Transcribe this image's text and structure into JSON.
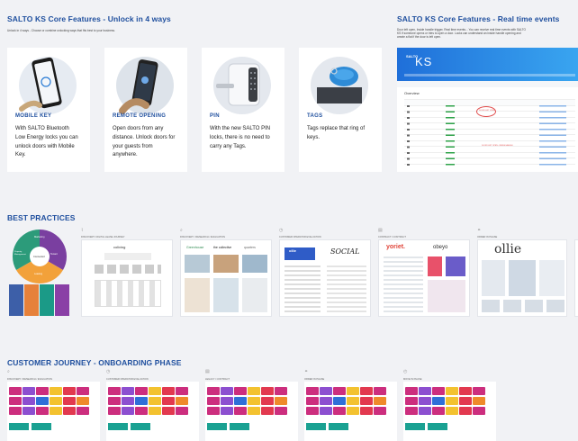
{
  "unlock_section": {
    "title": "SALTO KS Core Features  - Unlock in 4 ways",
    "subtitle": "Unlock in 4 ways - Choose or combine unlocking ways that fits best to your business.",
    "cards": [
      {
        "title": "MOBILE KEY",
        "description": "With SALTO Bluetooth Low Energy locks you can unlock doors with Mobile Key.",
        "icon": "smartphone-icon"
      },
      {
        "title": "REMOTE OPENING",
        "description": "Open doors from any distance. Unlock doors for your guests from anywhere.",
        "icon": "phone-in-hand-icon"
      },
      {
        "title": "PIN",
        "description": "With the new SALTO PIN locks, there is no need to carry any Tags.",
        "icon": "keypad-lock-icon"
      },
      {
        "title": "TAGS",
        "description": "Tags replace that ring of keys.",
        "icon": "key-tag-icon"
      }
    ]
  },
  "realtime_section": {
    "title": "SALTO KS Core Features  - Real time events",
    "subtitle_lines": [
      "Door left open, Inside handle trigger, Real time events... You can receive real time events with SALTO",
      "KS if someone opens or tries to open a door. Locks can understand an inside handle opening and",
      "create a flat if the door is left open."
    ],
    "app_logo": "KS",
    "app_brand": "SALTO",
    "panel_title": "Overview",
    "alert_text": "DOOR LEFT OPEN",
    "secondary_alert": "DOOR LEFT OPEN - INSIDE HANDLE",
    "table_rows": 13
  },
  "best_practices": {
    "title": "BEST PRACTICES",
    "wheel": {
      "top": "Marketing",
      "left": "Property Management",
      "right": "Tenant",
      "bottom": "Leasing",
      "center": "Connected"
    },
    "thumbs": [
      {
        "label": "DISCOVERY: DIGITAL LEASE JOURNEY",
        "icon": "paperclip-icon",
        "brand": "coliving"
      },
      {
        "label": "DISCOVERY / RESEARCH / EVALUATION",
        "icon": "search-icon",
        "brands": [
          "Greenhouse",
          "the collective",
          "quarters"
        ]
      },
      {
        "label": "CUSTOMER OPERATOR EVALUATION",
        "icon": "clock-icon",
        "brands": [
          "ollie",
          "SOCIAL"
        ]
      },
      {
        "label": "CONTRACT / CONTRACT",
        "icon": "document-icon",
        "brands": [
          "yoriet.",
          "obeyo"
        ]
      },
      {
        "label": "ORDER IN PHASE",
        "icon": "handshake-icon",
        "brand": "ollie"
      }
    ]
  },
  "customer_journey": {
    "title": "CUSTOMER JOURNEY - ONBOARDING PHASE",
    "phases": [
      {
        "label": "DISCOVERY / RESEARCH / EVALUATION",
        "icon": "search-icon"
      },
      {
        "label": "CUSTOMER OPERATOR EVALUATION",
        "icon": "clock-icon"
      },
      {
        "label": "LEGACY / CONTRACT",
        "icon": "document-icon"
      },
      {
        "label": "ORDER IN PHASE",
        "icon": "handshake-icon"
      },
      {
        "label": "MOVE IN PHASE",
        "icon": "calendar-icon"
      }
    ],
    "colors": {
      "magenta": "#cc2e7e",
      "yellow": "#f3c22f",
      "red": "#e2394f",
      "purple": "#8c4fd0",
      "orange": "#ef8a2b",
      "teal": "#1aa192",
      "blue": "#2f6fd8"
    }
  },
  "colors": {
    "accent": "#1f4f9e",
    "page_bg": "#f1f2f5"
  }
}
